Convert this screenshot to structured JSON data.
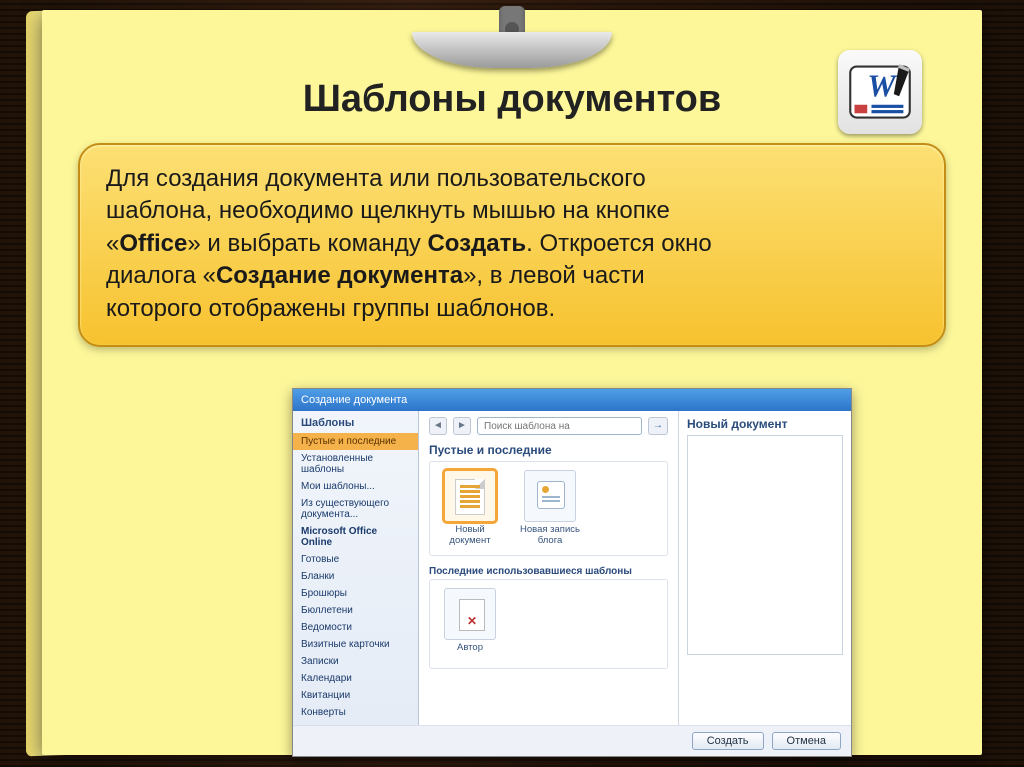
{
  "title": "Шаблоны документов",
  "note": {
    "t1": "Для создания документа или пользовательского",
    "t2": "шаблона, необходимо щелкнуть мышью на кнопке",
    "t3_a": "«",
    "t3_b": "Office",
    "t3_c": "» и выбрать команду ",
    "t3_d": "Создать",
    "t3_e": ". Откроется окно",
    "t4_a": "диалога «",
    "t4_b": "Создание документа",
    "t4_c": "», в левой части",
    "t5": "которого отображены группы шаблонов."
  },
  "dialog": {
    "title": "Создание документа",
    "search_placeholder": "Поиск шаблона на",
    "sidebar_header": "Шаблоны",
    "sidebar": [
      "Пустые и последние",
      "Установленные шаблоны",
      "Мои шаблоны...",
      "Из существующего документа...",
      "Microsoft Office Online",
      "Готовые",
      "Бланки",
      "Брошюры",
      "Бюллетени",
      "Ведомости",
      "Визитные карточки",
      "Записки",
      "Календари",
      "Квитанции",
      "Конверты"
    ],
    "section1": "Пустые и последние",
    "thumb1": "Новый документ",
    "thumb2": "Новая запись блога",
    "section2": "Последние использовавшиеся шаблоны",
    "thumb3": "Автор",
    "preview_header": "Новый документ",
    "btn_create": "Создать",
    "btn_cancel": "Отмена"
  }
}
